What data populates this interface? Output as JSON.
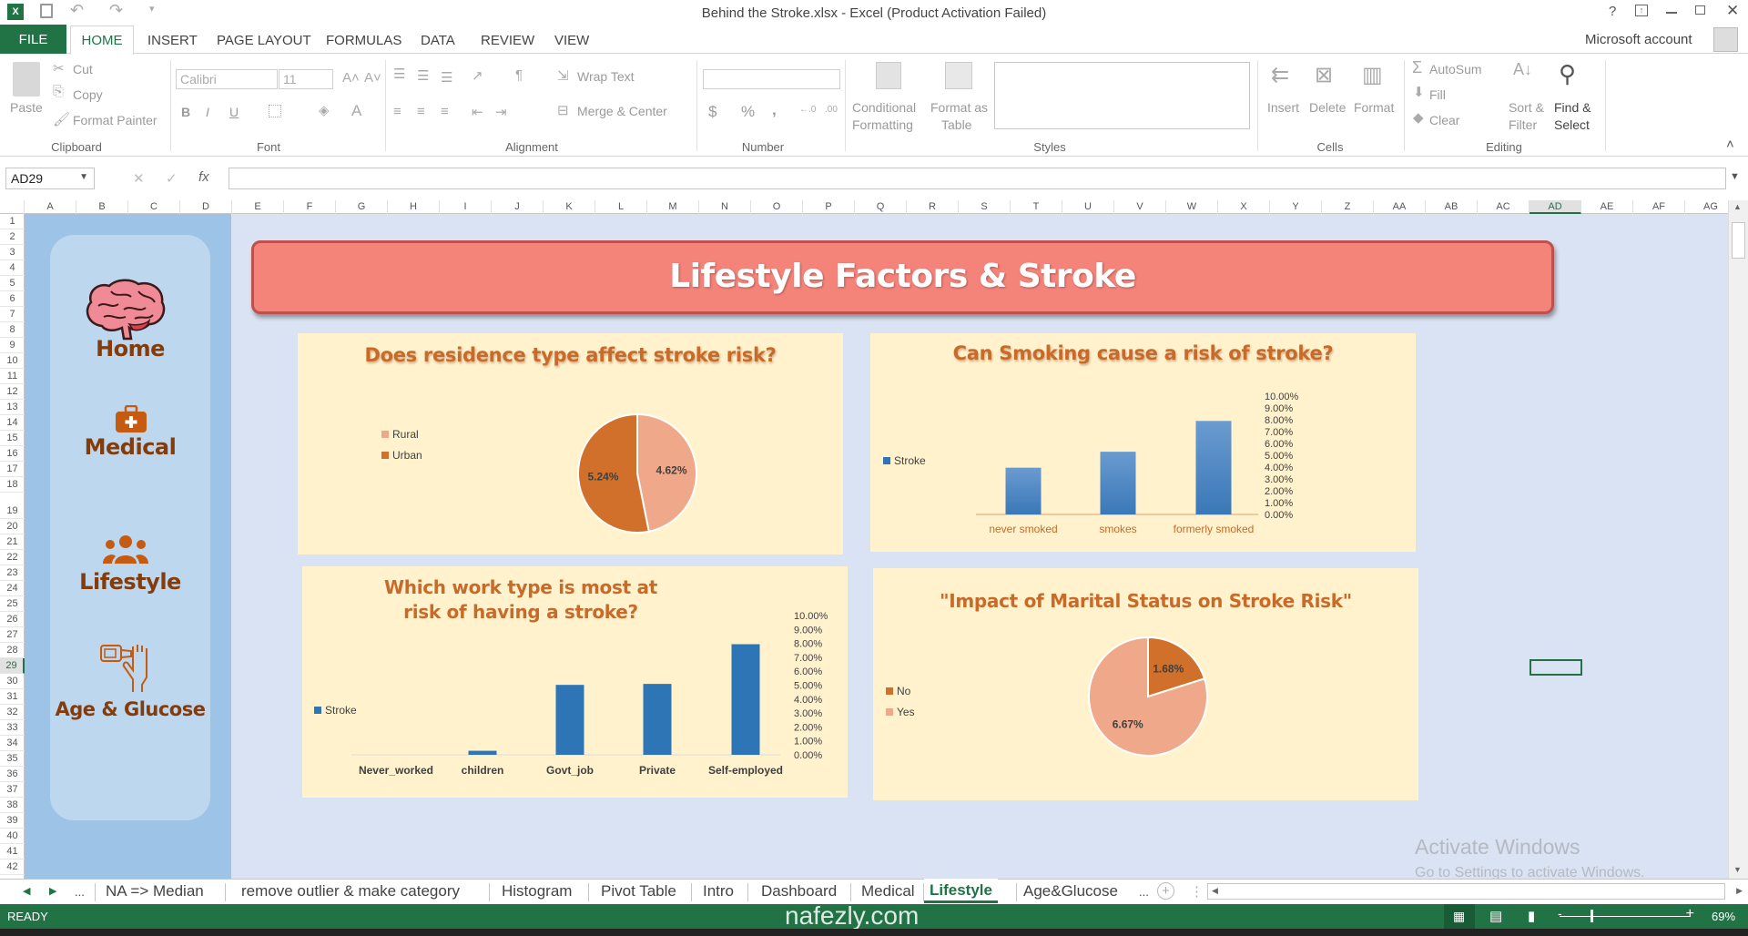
{
  "window": {
    "title": "Behind the Stroke.xlsx - Excel (Product Activation Failed)",
    "help": "?",
    "account": "Microsoft account"
  },
  "ribbon_tabs": [
    "FILE",
    "HOME",
    "INSERT",
    "PAGE LAYOUT",
    "FORMULAS",
    "DATA",
    "REVIEW",
    "VIEW"
  ],
  "ribbon": {
    "clipboard": {
      "paste": "Paste",
      "cut": "Cut",
      "copy": "Copy",
      "format_painter": "Format Painter",
      "label": "Clipboard"
    },
    "font": {
      "name": "Calibri",
      "size": "11",
      "bold": "B",
      "italic": "I",
      "underline": "U",
      "label": "Font"
    },
    "alignment": {
      "wrap_text": "Wrap Text",
      "merge_center": "Merge & Center",
      "label": "Alignment"
    },
    "number": {
      "format": "",
      "currency": "$",
      "percent": "%",
      "comma": ",",
      "label": "Number"
    },
    "styles": {
      "conditional_1": "Conditional",
      "conditional_2": "Formatting",
      "format_as_1": "Format as",
      "format_as_2": "Table",
      "label": "Styles"
    },
    "cells": {
      "insert": "Insert",
      "delete": "Delete",
      "format": "Format",
      "label": "Cells"
    },
    "editing": {
      "autosum": "AutoSum",
      "fill": "Fill",
      "clear": "Clear",
      "sort_1": "Sort &",
      "sort_2": "Filter",
      "find_1": "Find &",
      "find_2": "Select",
      "label": "Editing"
    }
  },
  "formula_bar": {
    "name_box": "AD29",
    "formula": "",
    "fx": "fx"
  },
  "columns": [
    "A",
    "B",
    "C",
    "D",
    "E",
    "F",
    "G",
    "H",
    "I",
    "J",
    "K",
    "L",
    "M",
    "N",
    "O",
    "P",
    "Q",
    "R",
    "S",
    "T",
    "U",
    "V",
    "W",
    "X",
    "Y",
    "Z",
    "AA",
    "AB",
    "AC",
    "AD",
    "AE",
    "AF",
    "AG"
  ],
  "rows": [
    1,
    2,
    3,
    4,
    5,
    6,
    7,
    8,
    9,
    10,
    11,
    12,
    13,
    14,
    15,
    16,
    17,
    18,
    19,
    20,
    21,
    22,
    23,
    24,
    25,
    26,
    27,
    28,
    29,
    30,
    31,
    32,
    33,
    34,
    35,
    36,
    37,
    38,
    39,
    40,
    41,
    42
  ],
  "selected": {
    "column": "AD",
    "row": 29
  },
  "sidebar": {
    "items": [
      {
        "label": "Home",
        "icon": "brain-icon"
      },
      {
        "label": "Medical",
        "icon": "briefcase-medical-icon"
      },
      {
        "label": "Lifestyle",
        "icon": "people-icon"
      },
      {
        "label": "Age & Glucose",
        "icon": "glucose-meter-icon"
      }
    ]
  },
  "banner": {
    "title": "Lifestyle Factors & Stroke"
  },
  "colors": {
    "pie_dark": "#d0702a",
    "pie_light": "#f0a88a",
    "bar": "#2e75b6",
    "chart_bg": "#fff2cc",
    "title": "#c86a2a",
    "excel_green": "#217346"
  },
  "chart_data": [
    {
      "type": "pie",
      "title": "Does residence type affect stroke risk?",
      "categories": [
        "Rural",
        "Urban"
      ],
      "values": [
        4.62,
        5.24
      ],
      "labels": [
        "4.62%",
        "5.24%"
      ],
      "legend": "left"
    },
    {
      "type": "bar",
      "title": "Can Smoking cause a risk of stroke?",
      "categories": [
        "never smoked",
        "smokes",
        "formerly smoked"
      ],
      "series": [
        {
          "name": "Stroke",
          "values": [
            3.95,
            5.3,
            7.9
          ]
        }
      ],
      "ylim": [
        0,
        10
      ],
      "y_ticks": [
        "0.00%",
        "1.00%",
        "2.00%",
        "3.00%",
        "4.00%",
        "5.00%",
        "6.00%",
        "7.00%",
        "8.00%",
        "9.00%",
        "10.00%"
      ],
      "legend": "left"
    },
    {
      "type": "bar",
      "title": "Which work type is most at risk of having a stroke?",
      "categories": [
        "Never_worked",
        "children",
        "Govt_job",
        "Private",
        "Self-employed"
      ],
      "series": [
        {
          "name": "Stroke",
          "values": [
            0,
            0.29,
            5.02,
            5.09,
            7.94
          ]
        }
      ],
      "ylim": [
        0,
        10
      ],
      "y_ticks": [
        "0.00%",
        "1.00%",
        "2.00%",
        "3.00%",
        "4.00%",
        "5.00%",
        "6.00%",
        "7.00%",
        "8.00%",
        "9.00%",
        "10.00%"
      ],
      "legend": "left"
    },
    {
      "type": "pie",
      "title": "\"Impact of Marital Status on Stroke Risk\"",
      "categories": [
        "No",
        "Yes"
      ],
      "values": [
        1.68,
        6.67
      ],
      "labels": [
        "1.68%",
        "6.67%"
      ],
      "legend": "left"
    }
  ],
  "sheet_tabs": {
    "items": [
      "NA => Median",
      "remove outlier & make category",
      "Histogram",
      "Pivot Table",
      "Intro",
      "Dashboard",
      "Medical",
      "Lifestyle",
      "Age&Glucose"
    ],
    "active": "Lifestyle",
    "more": "..."
  },
  "watermark": {
    "activate": "Activate Windows",
    "settings": "Go to Settings to activate Windows.",
    "site": "nafezly.com"
  },
  "status": {
    "ready": "READY",
    "zoom": "69%",
    "zoom_value": 69
  }
}
